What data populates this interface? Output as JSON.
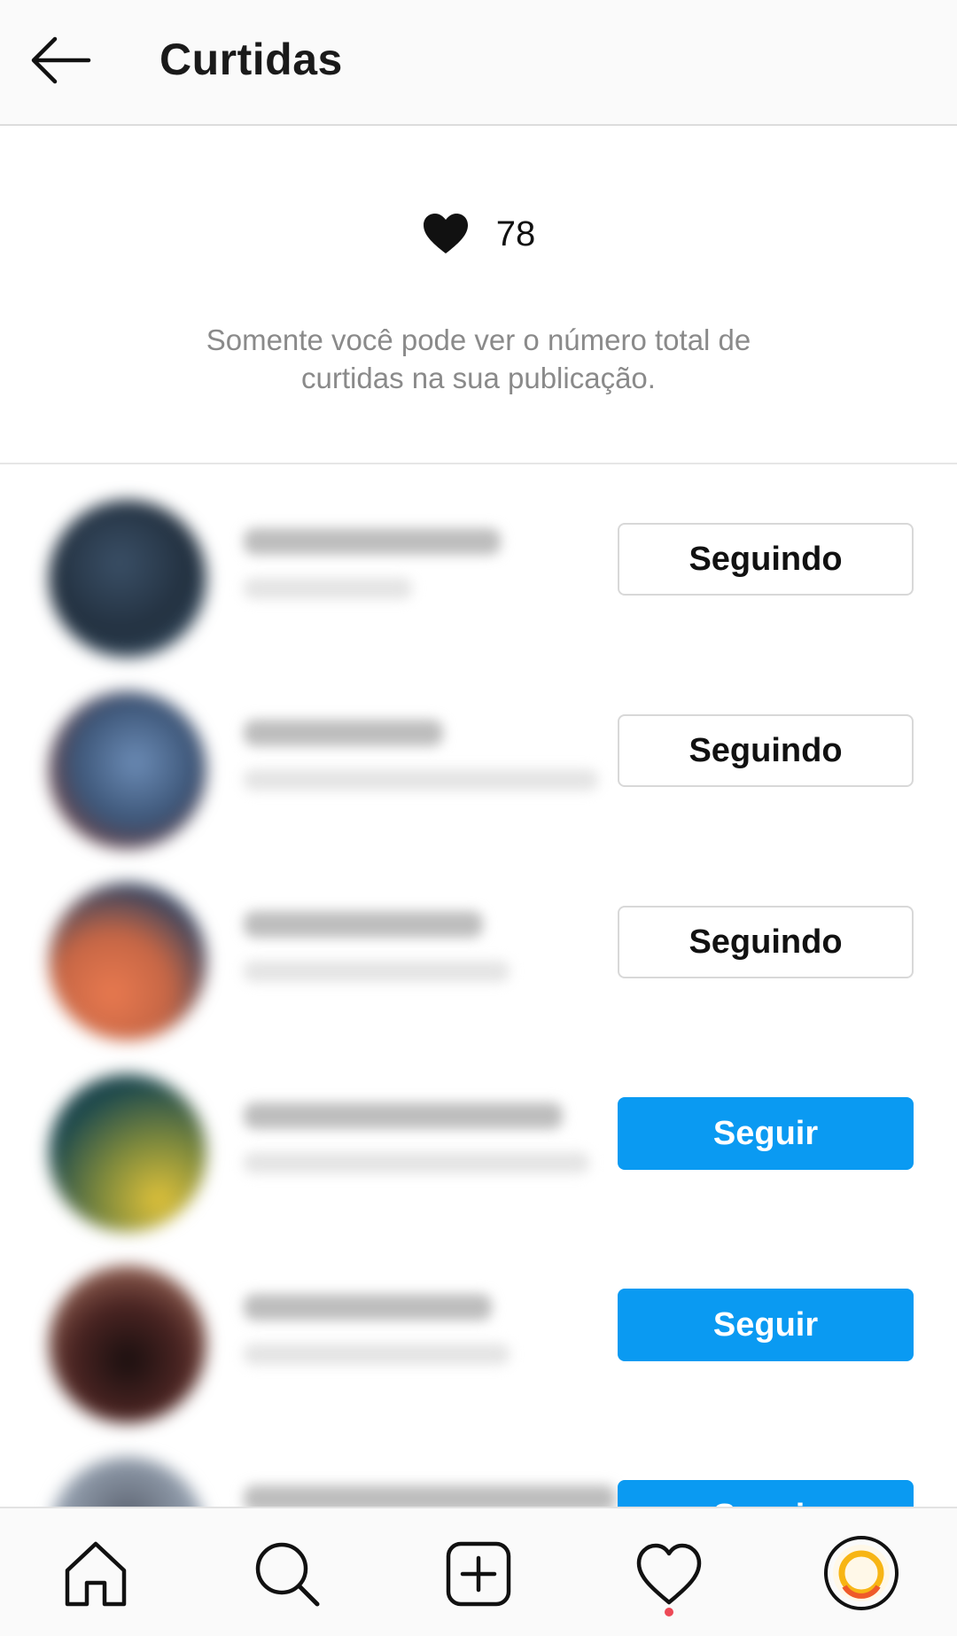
{
  "header": {
    "title": "Curtidas",
    "back_icon": "arrow-left-icon"
  },
  "likes": {
    "count": "78",
    "icon": "heart-filled-icon",
    "note": "Somente você pode ver o número total de curtidas na sua publicação."
  },
  "likers": [
    {
      "button_label": "Seguindo",
      "button_state": "following"
    },
    {
      "button_label": "Seguindo",
      "button_state": "following"
    },
    {
      "button_label": "Seguindo",
      "button_state": "following"
    },
    {
      "button_label": "Seguir",
      "button_state": "follow"
    },
    {
      "button_label": "Seguir",
      "button_state": "follow"
    },
    {
      "button_label": "Seguir",
      "button_state": "follow"
    }
  ],
  "bottom_nav": {
    "items": [
      "home-icon",
      "search-icon",
      "new-post-icon",
      "activity-heart-icon",
      "profile-avatar"
    ],
    "activity_has_notification": true
  },
  "colors": {
    "follow_button": "#0a9af2",
    "notification_dot": "#ed4956",
    "secondary_text": "#8a8a8a"
  }
}
